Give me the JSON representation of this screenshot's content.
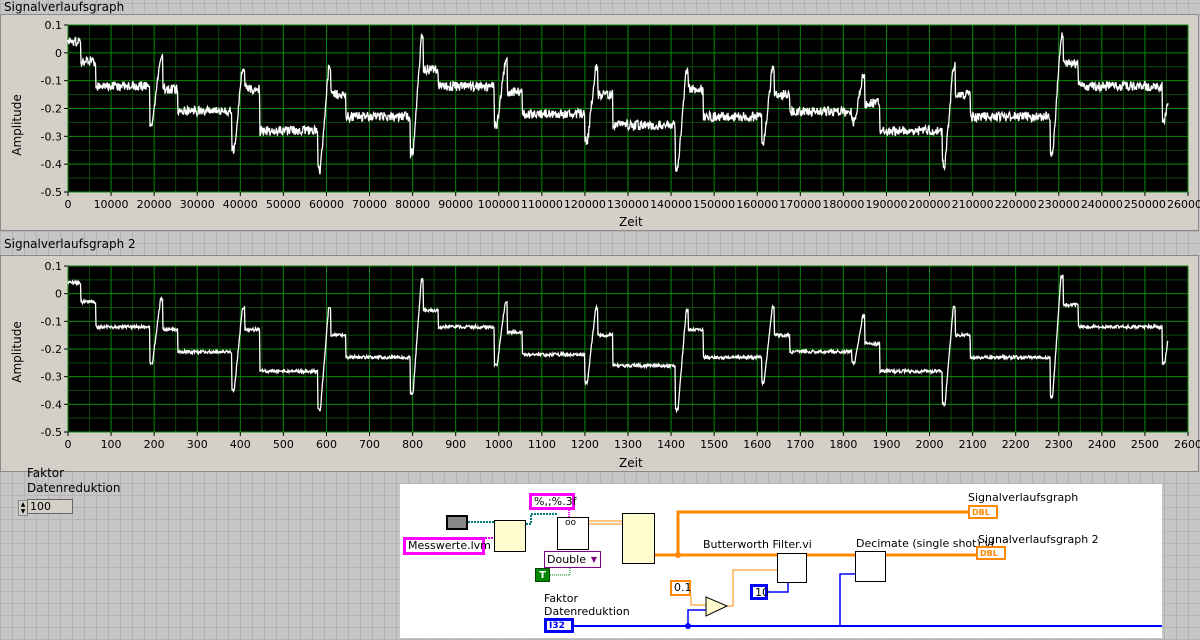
{
  "graph1": {
    "title": "Signalverlaufsgraph",
    "ylabel": "Amplitude",
    "xlabel": "Zeit",
    "yticks": [
      "0.1",
      "0",
      "-0.1",
      "-0.2",
      "-0.3",
      "-0.4",
      "-0.5"
    ],
    "xticks": [
      "0",
      "10000",
      "20000",
      "30000",
      "40000",
      "50000",
      "60000",
      "70000",
      "80000",
      "90000",
      "100000",
      "110000",
      "120000",
      "130000",
      "140000",
      "150000",
      "160000",
      "170000",
      "180000",
      "190000",
      "200000",
      "210000",
      "220000",
      "230000",
      "240000",
      "250000",
      "260000"
    ]
  },
  "graph2": {
    "title": "Signalverlaufsgraph 2",
    "ylabel": "Amplitude",
    "xlabel": "Zeit",
    "yticks": [
      "0.1",
      "0",
      "-0.1",
      "-0.2",
      "-0.3",
      "-0.4",
      "-0.5"
    ],
    "xticks": [
      "0",
      "100",
      "200",
      "300",
      "400",
      "500",
      "600",
      "700",
      "800",
      "900",
      "1000",
      "1100",
      "1200",
      "1300",
      "1400",
      "1500",
      "1600",
      "1700",
      "1800",
      "1900",
      "2000",
      "2100",
      "2200",
      "2300",
      "2400",
      "2500",
      "2600"
    ]
  },
  "control": {
    "label_line1": "Faktor",
    "label_line2": "Datenreduktion",
    "value": "100"
  },
  "diagram": {
    "file_path": "Messwerte.lvm",
    "format_string": "%,;%.3f",
    "type_select": "Double",
    "bool_const": "T",
    "butterworth_label": "Butterworth Filter.vi",
    "decimate_label": "Decimate (single shot).vi",
    "const_01": "0.1",
    "const_10": "10",
    "faktor_label_1": "Faktor",
    "faktor_label_2": "Datenreduktion",
    "faktor_terminal": "I32",
    "out1_label": "Signalverlaufsgraph",
    "out2_label": "Signalverlaufsgraph 2",
    "out_terminal": "DBL"
  },
  "colors": {
    "plot_bg": "#000000",
    "grid": "#0a6e0a",
    "trace": "#ffffff",
    "wire_dbl": "#ff8000",
    "wire_i32": "#0000ff",
    "string": "#ff00ff"
  }
}
